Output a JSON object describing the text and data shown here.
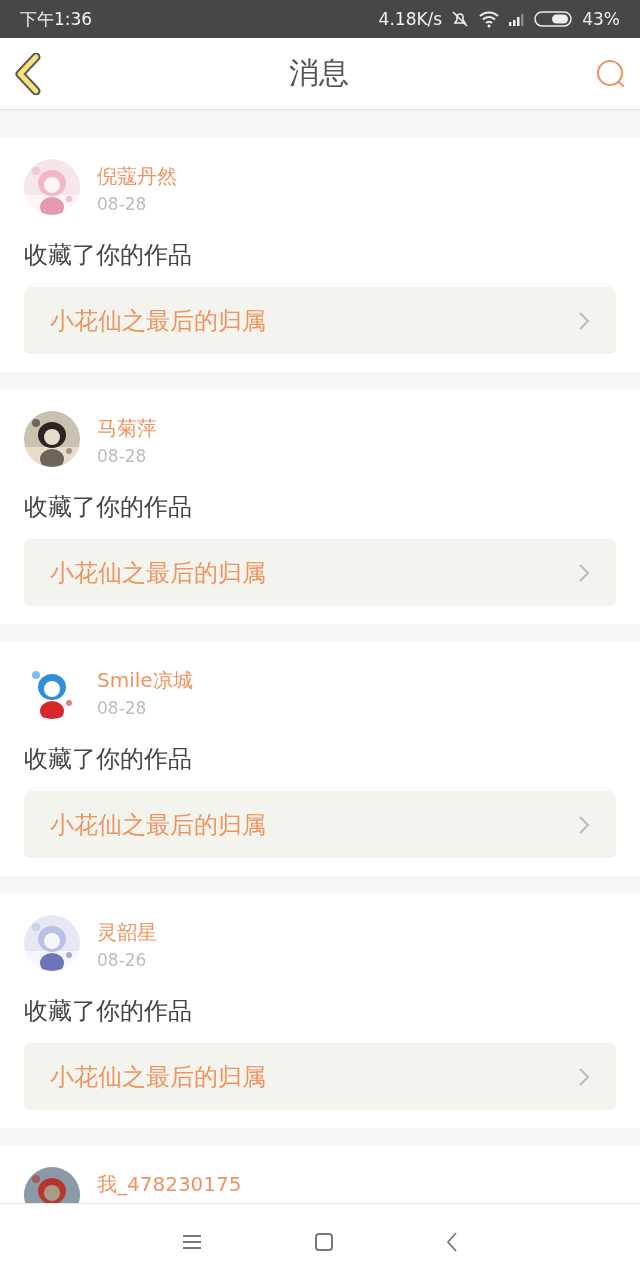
{
  "status_bar": {
    "time": "下午1:36",
    "net_speed": "4.18K/s",
    "battery": "43%"
  },
  "header": {
    "title": "消息"
  },
  "messages": [
    {
      "name": "倪蔻丹然",
      "date": "08-28",
      "action": "收藏了你的作品",
      "work": "小花仙之最后的归属"
    },
    {
      "name": "马菊萍",
      "date": "08-28",
      "action": "收藏了你的作品",
      "work": "小花仙之最后的归属"
    },
    {
      "name": "Smile凉城",
      "date": "08-28",
      "action": "收藏了你的作品",
      "work": "小花仙之最后的归属"
    },
    {
      "name": "灵韶星",
      "date": "08-26",
      "action": "收藏了你的作品",
      "work": "小花仙之最后的归属"
    },
    {
      "name": "我_478230175"
    }
  ]
}
